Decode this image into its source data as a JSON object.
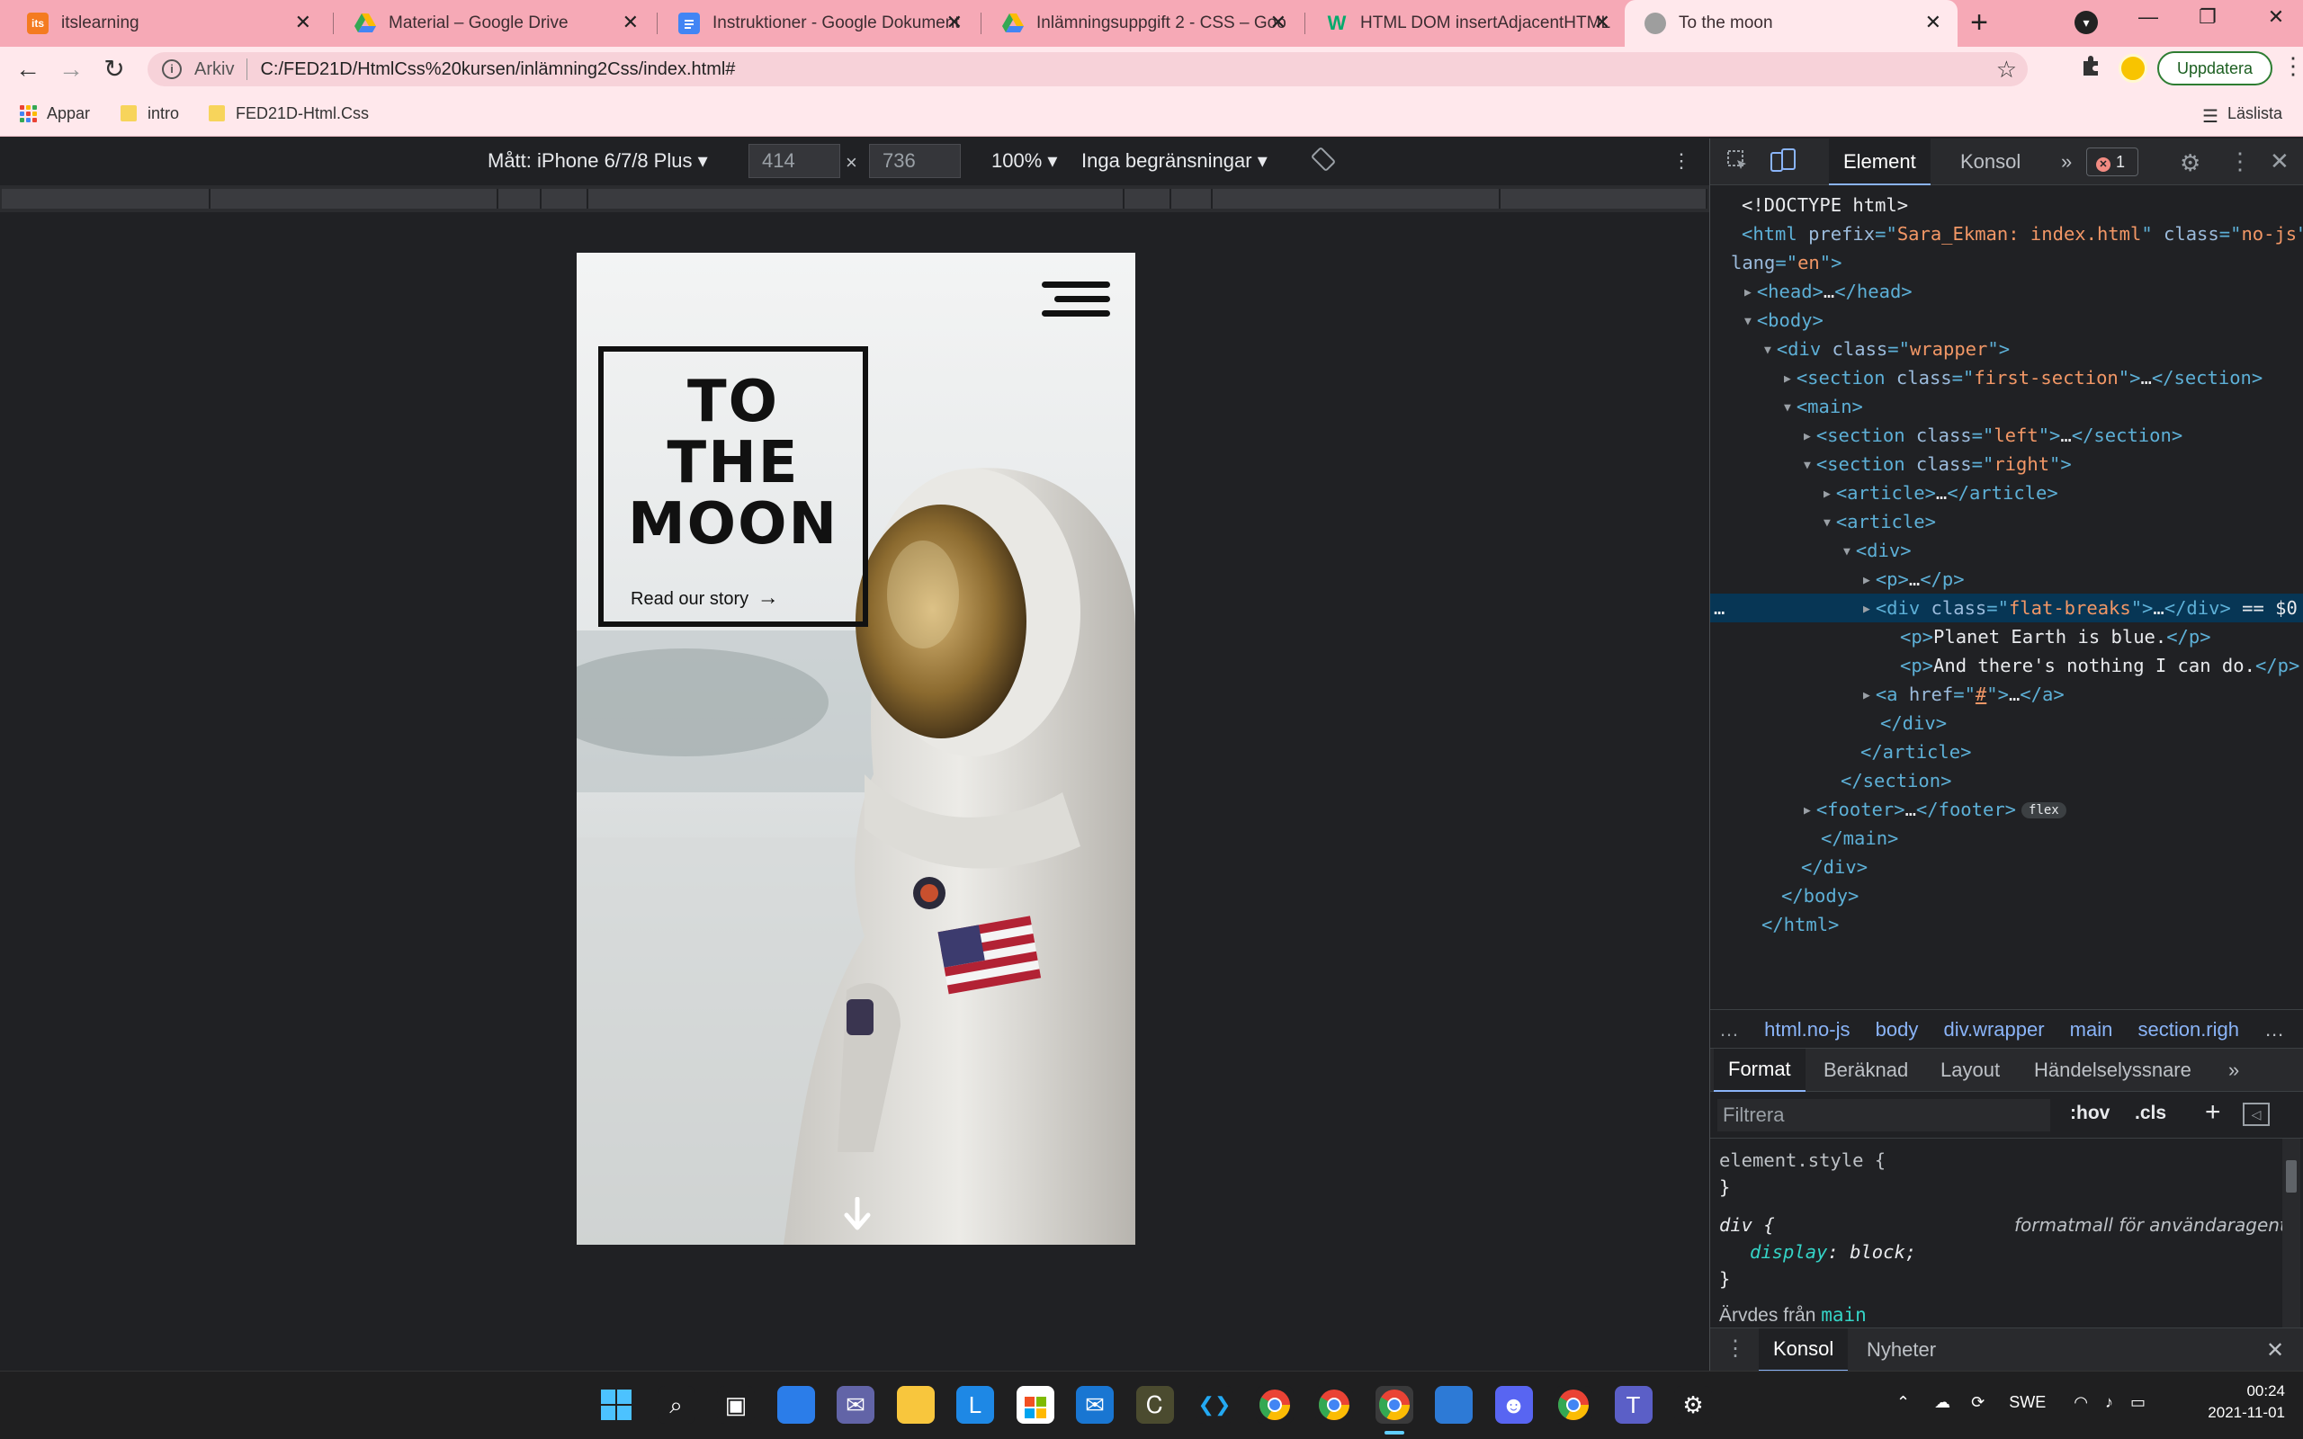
{
  "browser": {
    "tabs": [
      {
        "title": "itslearning",
        "favicon": "itslearning-logo",
        "color": "#f47b20"
      },
      {
        "title": "Material – Google Drive",
        "favicon": "google-drive-logo",
        "color": "#34a853"
      },
      {
        "title": "Instruktioner - Google Dokument",
        "favicon": "google-docs-logo",
        "color": "#4285f4"
      },
      {
        "title": "Inlämningsuppgift 2 - CSS – Goo",
        "favicon": "google-drive-logo",
        "color": "#fbbc04"
      },
      {
        "title": "HTML DOM insertAdjacentHTML",
        "favicon": "w3schools-logo",
        "color": "#04aa6d"
      },
      {
        "title": "To the moon",
        "favicon": "moon-globe",
        "color": "#9e9e9e"
      }
    ],
    "address": {
      "security_label": "Arkiv",
      "url": "C:/FED21D/HtmlCss%20kursen/inlämning2Css/index.html#"
    },
    "update_button": "Uppdatera",
    "bookmarks": [
      {
        "label": "Appar",
        "icon": "apps-grid-icon"
      },
      {
        "label": "intro",
        "icon": "folder-icon"
      },
      {
        "label": "FED21D-Html.Css",
        "icon": "folder-icon"
      }
    ],
    "reading_list": "Läslista",
    "accent": "#f6a9b6"
  },
  "device_toolbar": {
    "device": "Mått: iPhone 6/7/8 Plus",
    "width": "414",
    "height": "736",
    "times": "×",
    "zoom": "100%",
    "throttle": "Inga begränsningar"
  },
  "page": {
    "title_lines": [
      "TO",
      "THE",
      "MOON"
    ],
    "cta": "Read our story",
    "cta_arrow": "→"
  },
  "devtools": {
    "tabs": [
      "Element",
      "Konsol"
    ],
    "more": "»",
    "error_count": "1",
    "dom_lines": [
      {
        "indent": 0,
        "parts": [
          [
            "tx",
            "<!DOCTYPE html>"
          ]
        ]
      },
      {
        "indent": 0,
        "parts": [
          [
            "tg",
            "<html "
          ],
          [
            "an",
            "prefix"
          ],
          [
            "tg",
            "=\""
          ],
          [
            "av",
            "Sara_Ekman: index.html"
          ],
          [
            "tg",
            "\" "
          ],
          [
            "an",
            "class"
          ],
          [
            "tg",
            "=\""
          ],
          [
            "av",
            "no-js"
          ],
          [
            "tg",
            "\""
          ]
        ]
      },
      {
        "indent": -1,
        "parts": [
          [
            "an",
            "lang"
          ],
          [
            "tg",
            "=\""
          ],
          [
            "av",
            "en"
          ],
          [
            "tg",
            "\">"
          ]
        ]
      },
      {
        "indent": 1,
        "tri": "▶",
        "parts": [
          [
            "tg",
            "<head>"
          ],
          [
            "tx",
            "…"
          ],
          [
            "tg",
            "</head>"
          ]
        ]
      },
      {
        "indent": 1,
        "tri": "▼",
        "parts": [
          [
            "tg",
            "<body>"
          ]
        ]
      },
      {
        "indent": 2,
        "tri": "▼",
        "parts": [
          [
            "tg",
            "<div "
          ],
          [
            "an",
            "class"
          ],
          [
            "tg",
            "=\""
          ],
          [
            "av",
            "wrapper"
          ],
          [
            "tg",
            "\">"
          ]
        ]
      },
      {
        "indent": 3,
        "tri": "▶",
        "parts": [
          [
            "tg",
            "<section "
          ],
          [
            "an",
            "class"
          ],
          [
            "tg",
            "=\""
          ],
          [
            "av",
            "first-section"
          ],
          [
            "tg",
            "\">"
          ],
          [
            "tx",
            "…"
          ],
          [
            "tg",
            "</section>"
          ]
        ]
      },
      {
        "indent": 3,
        "tri": "▼",
        "parts": [
          [
            "tg",
            "<main>"
          ]
        ]
      },
      {
        "indent": 4,
        "tri": "▶",
        "parts": [
          [
            "tg",
            "<section "
          ],
          [
            "an",
            "class"
          ],
          [
            "tg",
            "=\""
          ],
          [
            "av",
            "left"
          ],
          [
            "tg",
            "\">"
          ],
          [
            "tx",
            "…"
          ],
          [
            "tg",
            "</section>"
          ]
        ]
      },
      {
        "indent": 4,
        "tri": "▼",
        "parts": [
          [
            "tg",
            "<section "
          ],
          [
            "an",
            "class"
          ],
          [
            "tg",
            "=\""
          ],
          [
            "av",
            "right"
          ],
          [
            "tg",
            "\">"
          ]
        ]
      },
      {
        "indent": 5,
        "tri": "▶",
        "parts": [
          [
            "tg",
            "<article>"
          ],
          [
            "tx",
            "…"
          ],
          [
            "tg",
            "</article>"
          ]
        ]
      },
      {
        "indent": 5,
        "tri": "▼",
        "parts": [
          [
            "tg",
            "<article>"
          ]
        ]
      },
      {
        "indent": 6,
        "tri": "▼",
        "parts": [
          [
            "tg",
            "<div>"
          ]
        ]
      },
      {
        "indent": 7,
        "tri": "▶",
        "parts": [
          [
            "tg",
            "<p>"
          ],
          [
            "tx",
            "…"
          ],
          [
            "tg",
            "</p>"
          ]
        ]
      },
      {
        "indent": 7,
        "tri": "▶",
        "selected": true,
        "parts": [
          [
            "tg",
            "<div "
          ],
          [
            "an",
            "class"
          ],
          [
            "tg",
            "=\""
          ],
          [
            "av",
            "flat-breaks"
          ],
          [
            "tg",
            "\">"
          ],
          [
            "tx",
            "…"
          ],
          [
            "tg",
            "</div>"
          ],
          [
            "tx",
            " == $0"
          ]
        ]
      },
      {
        "indent": 8,
        "parts": [
          [
            "tg",
            "<p>"
          ],
          [
            "tx",
            "Planet Earth is blue."
          ],
          [
            "tg",
            "</p>"
          ]
        ]
      },
      {
        "indent": 8,
        "parts": [
          [
            "tg",
            "<p>"
          ],
          [
            "tx",
            "And there's nothing I can do."
          ],
          [
            "tg",
            "</p>"
          ]
        ]
      },
      {
        "indent": 7,
        "tri": "▶",
        "parts": [
          [
            "tg",
            "<a "
          ],
          [
            "an",
            "href"
          ],
          [
            "tg",
            "=\""
          ],
          [
            "av",
            "#"
          ],
          [
            "tg",
            "\">"
          ],
          [
            "tx",
            "…"
          ],
          [
            "tg",
            "</a>"
          ]
        ]
      },
      {
        "indent": 7,
        "parts": [
          [
            "tg",
            "</div>"
          ]
        ]
      },
      {
        "indent": 6,
        "parts": [
          [
            "tg",
            "</article>"
          ]
        ]
      },
      {
        "indent": 5,
        "parts": [
          [
            "tg",
            "</section>"
          ]
        ]
      },
      {
        "indent": 4,
        "tri": "▶",
        "pill": "flex",
        "parts": [
          [
            "tg",
            "<footer>"
          ],
          [
            "tx",
            "…"
          ],
          [
            "tg",
            "</footer>"
          ]
        ]
      },
      {
        "indent": 4,
        "parts": [
          [
            "tg",
            "</main>"
          ]
        ]
      },
      {
        "indent": 3,
        "parts": [
          [
            "tg",
            "</div>"
          ]
        ]
      },
      {
        "indent": 2,
        "parts": [
          [
            "tg",
            "</body>"
          ]
        ]
      },
      {
        "indent": 1,
        "parts": [
          [
            "tg",
            "</html>"
          ]
        ]
      }
    ],
    "selected_marker": "…",
    "breadcrumbs": [
      "…",
      "html.no-js",
      "body",
      "div.wrapper",
      "main",
      "section.righ",
      "…"
    ],
    "style_tabs": [
      "Format",
      "Beräknad",
      "Layout",
      "Händelselyssnare"
    ],
    "filter_placeholder": "Filtrera",
    "filter_buttons": [
      ":hov",
      ".cls",
      "+"
    ],
    "styles": {
      "element_style": "element.style {",
      "close": "}",
      "div_selector": "div {",
      "ua_note": "formatmall för användaragent",
      "prop": "display",
      "val": "block;",
      "inherited_label": "Ärvdes från",
      "inherited_from": "main"
    },
    "drawer_tabs": [
      "Konsol",
      "Nyheter"
    ]
  },
  "taskbar": {
    "lang": "SWE",
    "time": "00:24",
    "date": "2021-11-01",
    "apps": [
      "windows-start",
      "search",
      "task-view",
      "widgets",
      "teams-chat",
      "file-explorer",
      "l-app",
      "microsoft-store",
      "mail",
      "edge-app",
      "vs-code",
      "chrome",
      "chrome-profile",
      "chrome-active",
      "photos",
      "discord",
      "chrome-profile-2",
      "teams",
      "settings"
    ]
  }
}
